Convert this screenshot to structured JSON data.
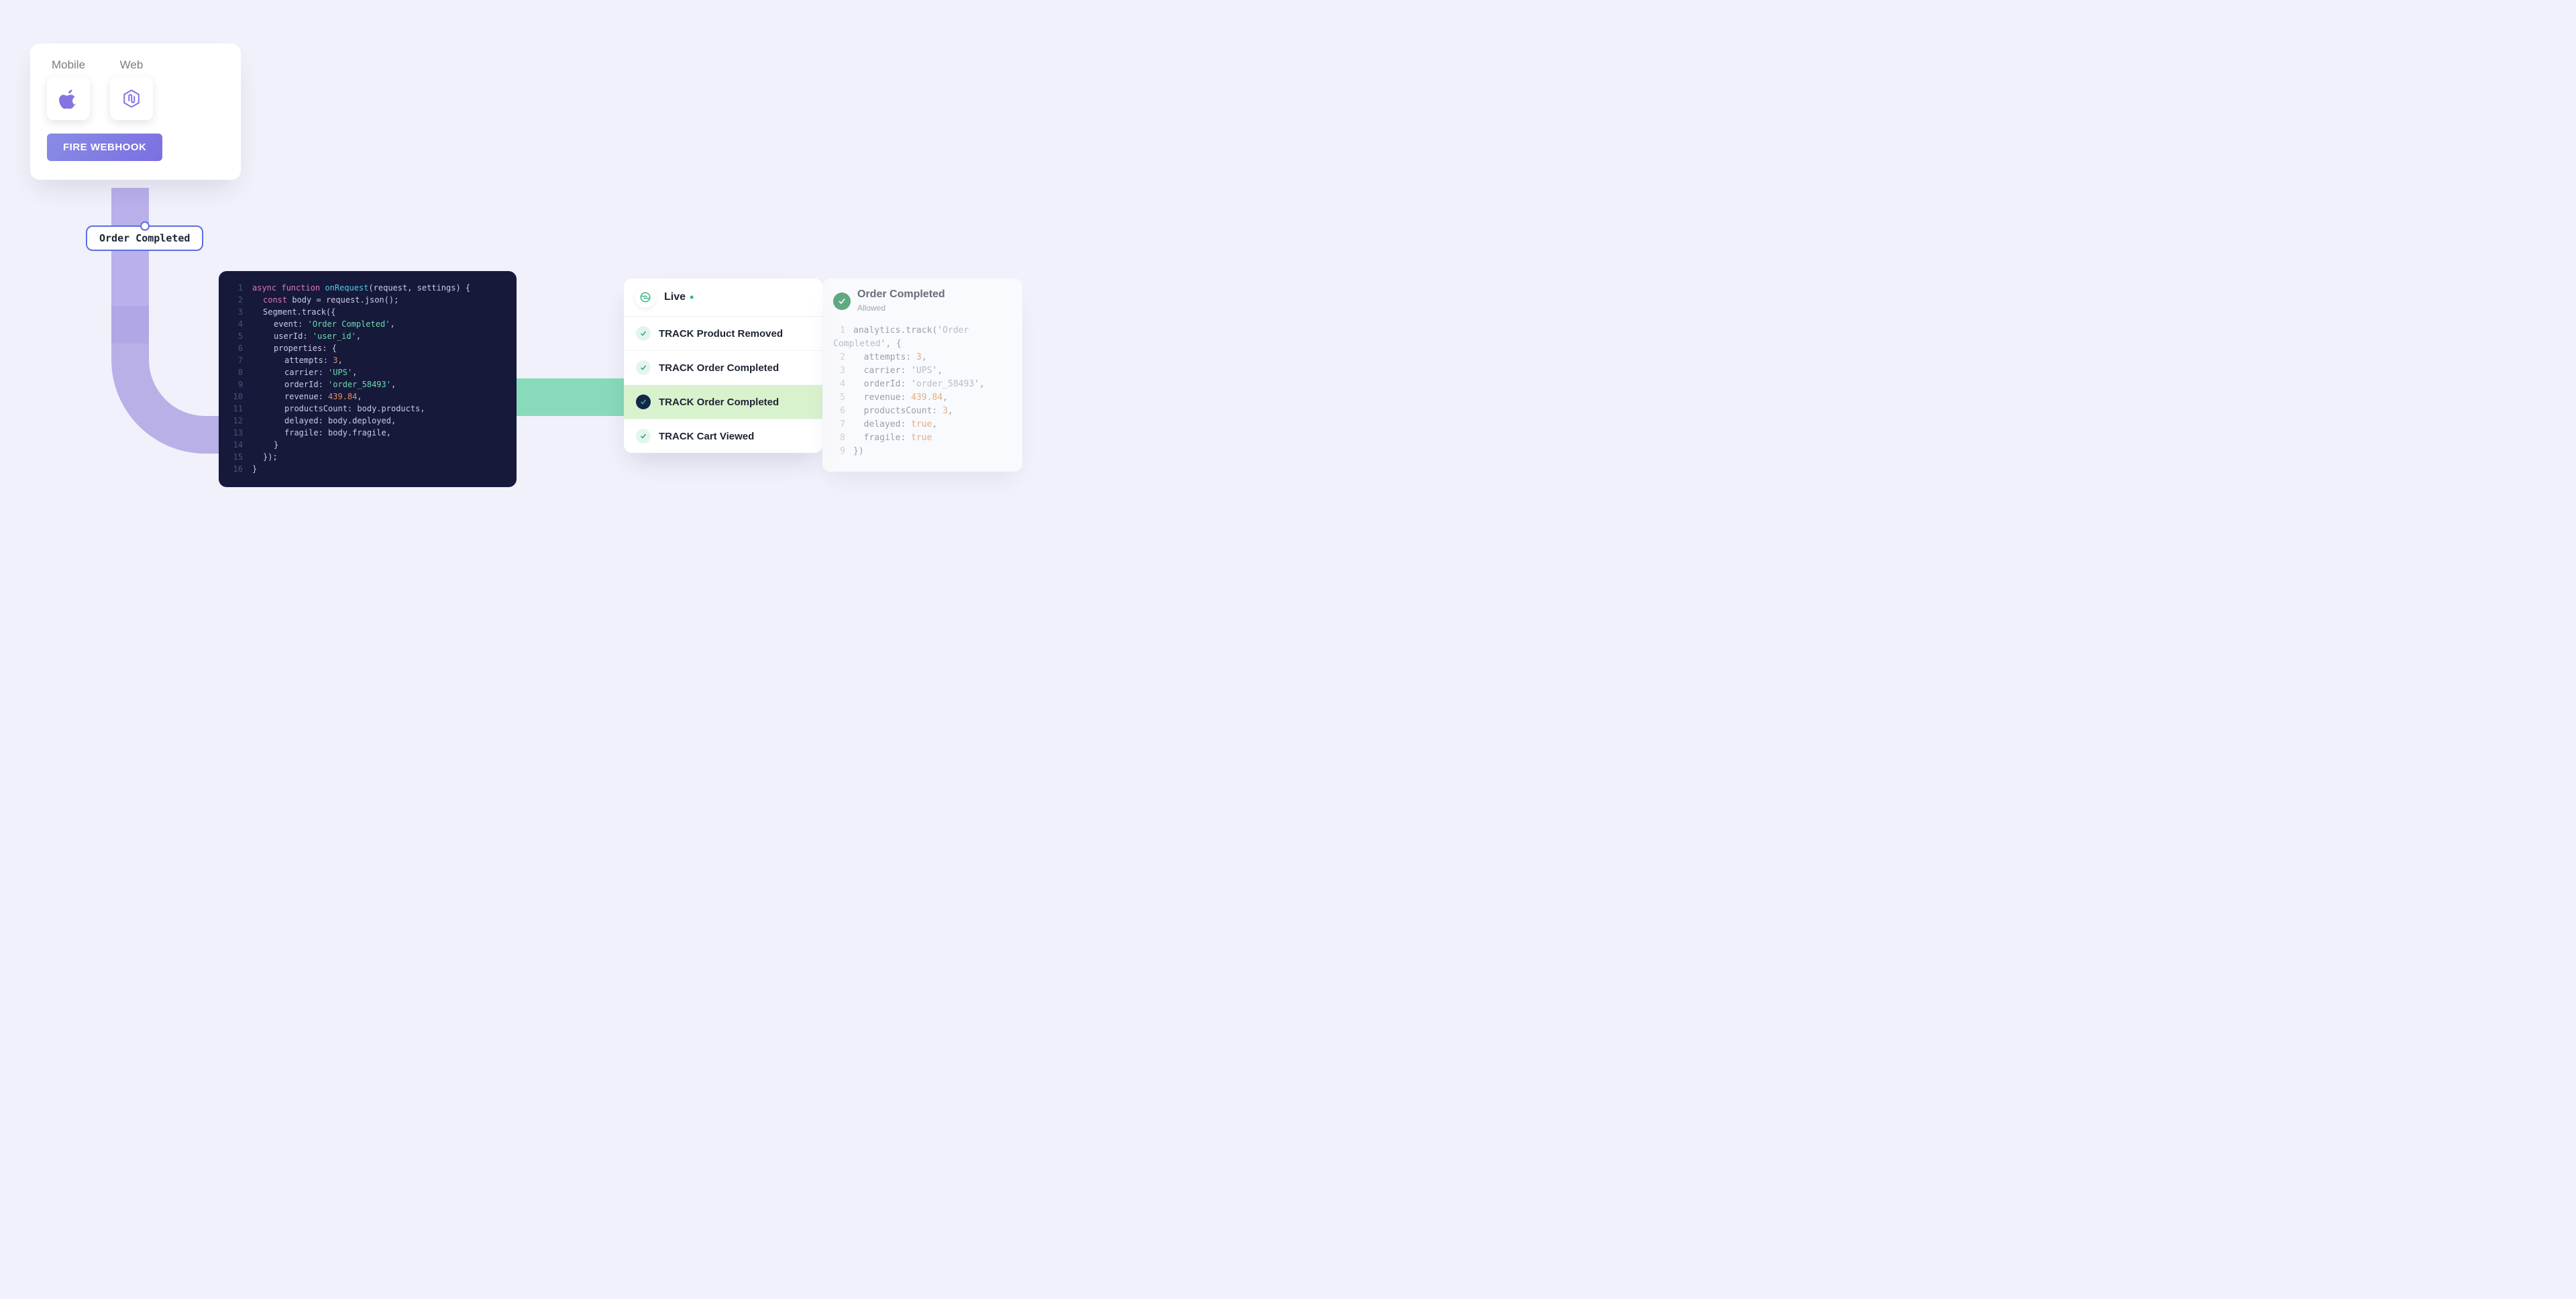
{
  "sources": {
    "mobile_label": "Mobile",
    "web_label": "Web",
    "fire_button": "FIRE WEBHOOK"
  },
  "badge": {
    "event": "Order Completed"
  },
  "code": {
    "fn": "onRequest",
    "params": "request, settings",
    "track_call": "Segment.track",
    "event": "Order Completed",
    "userId": "user_id",
    "attempts": "3",
    "carrier": "UPS",
    "orderId": "order_58493",
    "revenue": "439.84",
    "productsCountExpr": "body.products",
    "delayedExpr": "body.deployed",
    "fragileExpr": "body.fragile"
  },
  "events": {
    "header": "Live",
    "rows": [
      {
        "label": "TRACK Product Removed",
        "selected": false
      },
      {
        "label": "TRACK Order Completed",
        "selected": false
      },
      {
        "label": "TRACK Order Completed",
        "selected": true
      },
      {
        "label": "TRACK Cart Viewed",
        "selected": false
      }
    ]
  },
  "detail": {
    "title": "Order Completed",
    "subtitle": "Allowed",
    "call": "analytics.track",
    "event": "Order Completed",
    "attempts": "3",
    "carrier": "UPS",
    "orderId": "order_58493",
    "revenue": "439.84",
    "productsCount": "3",
    "delayed": "true",
    "fragile": "true"
  }
}
